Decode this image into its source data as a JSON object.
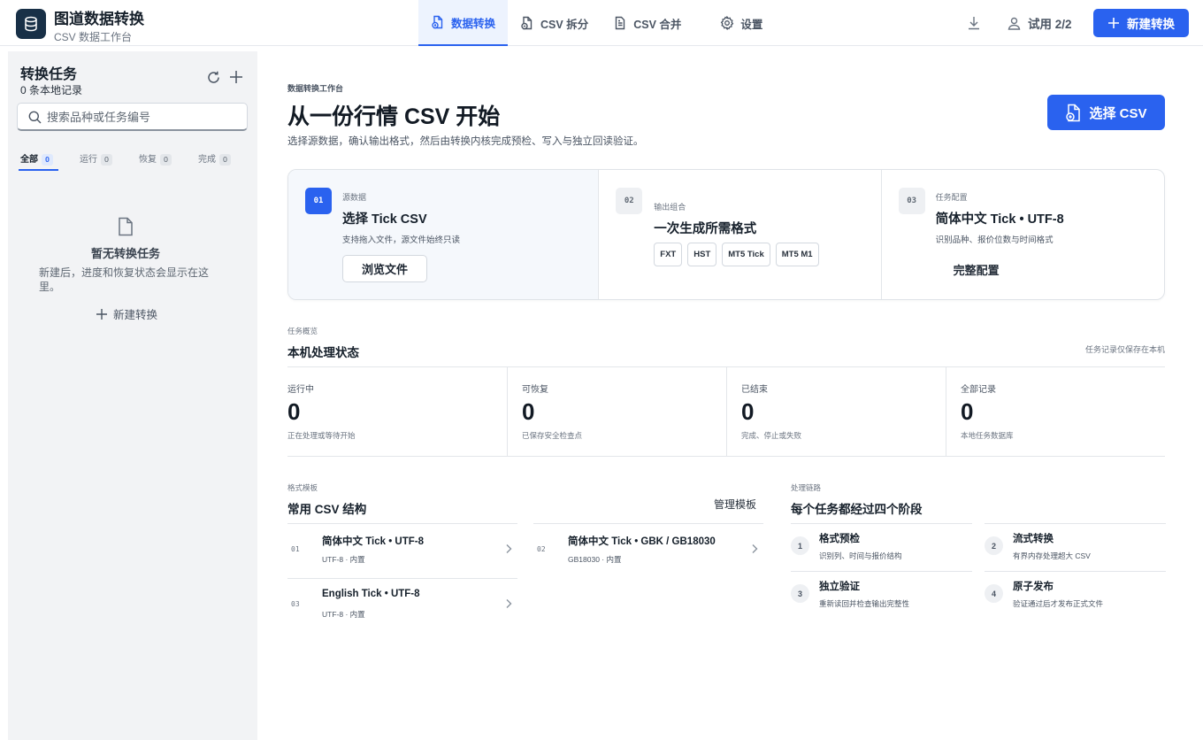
{
  "app": {
    "title": "图道数据转换",
    "subtitle": "CSV 数据工作台"
  },
  "nav": [
    {
      "label": "数据转换",
      "icon": "convert-icon",
      "active": true
    },
    {
      "label": "CSV 拆分",
      "icon": "split-icon",
      "active": false
    },
    {
      "label": "CSV 合并",
      "icon": "merge-icon",
      "active": false
    },
    {
      "label": "设置",
      "icon": "gear-icon",
      "active": false
    }
  ],
  "header": {
    "trial_label": "试用 2/2",
    "new_button": "新建转换"
  },
  "sidebar": {
    "title": "转换任务",
    "count": "0 条本地记录",
    "search_placeholder": "搜索品种或任务编号",
    "tabs": [
      {
        "label": "全部",
        "count": "0",
        "active": true
      },
      {
        "label": "运行",
        "count": "0",
        "active": false
      },
      {
        "label": "恢复",
        "count": "0",
        "active": false
      },
      {
        "label": "完成",
        "count": "0",
        "active": false
      }
    ],
    "empty_title": "暂无转换任务",
    "empty_desc": "新建后，进度和恢复状态会显示在这里。",
    "empty_new": "新建转换"
  },
  "hero": {
    "eyebrow": "数据转换工作台",
    "title": "从一份行情 CSV 开始",
    "desc": "选择源数据，确认输出格式，然后由转换内核完成预检、写入与独立回读验证。",
    "button": "选择 CSV"
  },
  "steps": [
    {
      "num": "01",
      "label": "源数据",
      "title": "选择 Tick CSV",
      "desc": "支持拖入文件，源文件始终只读",
      "action": "浏览文件"
    },
    {
      "num": "02",
      "label": "输出组合",
      "title": "一次生成所需格式",
      "chips": [
        "FXT",
        "HST",
        "MT5 Tick",
        "MT5 M1"
      ]
    },
    {
      "num": "03",
      "label": "任务配置",
      "title": "简体中文 Tick • UTF-8",
      "desc": "识别品种、报价位数与时间格式",
      "action": "完整配置"
    }
  ],
  "overview": {
    "eyebrow": "任务概览",
    "title": "本机处理状态",
    "note": "任务记录仅保存在本机",
    "stats": [
      {
        "label": "运行中",
        "value": "0",
        "desc": "正在处理或等待开始"
      },
      {
        "label": "可恢复",
        "value": "0",
        "desc": "已保存安全检查点"
      },
      {
        "label": "已结束",
        "value": "0",
        "desc": "完成、停止或失败"
      },
      {
        "label": "全部记录",
        "value": "0",
        "desc": "本地任务数据库"
      }
    ]
  },
  "templates": {
    "eyebrow": "格式模板",
    "title": "常用 CSV 结构",
    "manage": "管理模板",
    "items": [
      {
        "num": "01",
        "name": "简体中文 Tick • UTF-8",
        "meta": "UTF-8 · 内置"
      },
      {
        "num": "02",
        "name": "简体中文 Tick • GBK / GB18030",
        "meta": "GB18030 · 内置"
      },
      {
        "num": "03",
        "name": "English Tick • UTF-8",
        "meta": "UTF-8 · 内置"
      }
    ]
  },
  "process": {
    "eyebrow": "处理链路",
    "title": "每个任务都经过四个阶段",
    "stages": [
      {
        "num": "1",
        "name": "格式预检",
        "desc": "识别列、时间与报价结构"
      },
      {
        "num": "2",
        "name": "流式转换",
        "desc": "有界内存处理超大 CSV"
      },
      {
        "num": "3",
        "name": "独立验证",
        "desc": "重新读回并检查输出完整性"
      },
      {
        "num": "4",
        "name": "原子发布",
        "desc": "验证通过后才发布正式文件"
      }
    ]
  },
  "colors": {
    "accent": "#2a62ef",
    "logo_bg": "#183047",
    "sidebar_bg": "#f2f3f5"
  }
}
